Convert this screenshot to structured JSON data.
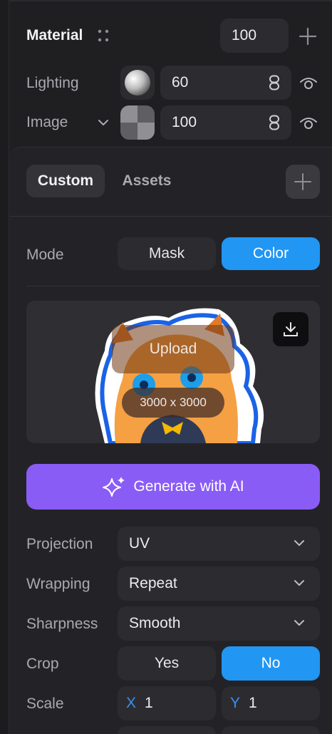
{
  "material": {
    "title": "Material",
    "value": "100"
  },
  "lighting": {
    "label": "Lighting",
    "value": "60"
  },
  "image": {
    "label": "Image",
    "value": "100"
  },
  "tabs": {
    "custom": "Custom",
    "assets": "Assets"
  },
  "mode": {
    "label": "Mode",
    "options": [
      "Mask",
      "Color"
    ],
    "selected": "Color"
  },
  "preview": {
    "upload_label": "Upload",
    "dimensions": "3000 x 3000"
  },
  "generate": {
    "label": "Generate with AI"
  },
  "projection": {
    "label": "Projection",
    "value": "UV"
  },
  "wrapping": {
    "label": "Wrapping",
    "value": "Repeat"
  },
  "sharpness": {
    "label": "Sharpness",
    "value": "Smooth"
  },
  "crop": {
    "label": "Crop",
    "options": [
      "Yes",
      "No"
    ],
    "selected": "No"
  },
  "scale": {
    "label": "Scale",
    "x_axis": "X",
    "x_value": "1",
    "y_axis": "Y",
    "y_value": "1"
  },
  "colors": {
    "accent_blue": "#2196f3",
    "generate_purple": "#8a5cf6",
    "panel_bg": "#1f1f22",
    "field_bg": "#2c2c30"
  }
}
